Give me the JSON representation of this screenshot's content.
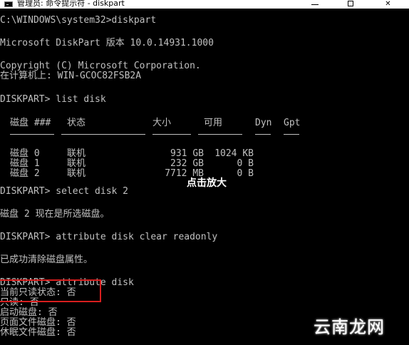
{
  "window": {
    "title": "管理员: 命令提示符 - diskpart",
    "minimize_glyph": "",
    "maximize_glyph": "",
    "close_glyph": "✕"
  },
  "console": {
    "prompt_cmd": "C:\\WINDOWS\\system32>diskpart",
    "version": "Microsoft DiskPart 版本 10.0.14931.1000",
    "copyright": "Copyright (C) Microsoft Corporation.",
    "computer": "在计算机上: WIN-GCOC82FSB2A",
    "list_cmd": "DISKPART> list disk",
    "table": {
      "headers": [
        "磁盘 ###",
        "状态",
        "大小",
        "可用",
        "Dyn",
        "Gpt"
      ],
      "rows": [
        [
          "磁盘 0",
          "联机",
          "931 GB",
          "1024 KB",
          "",
          ""
        ],
        [
          "磁盘 1",
          "联机",
          "232 GB",
          "0 B",
          "",
          ""
        ],
        [
          "磁盘 2",
          "联机",
          "7712 MB",
          "0 B",
          "",
          ""
        ]
      ]
    },
    "select_cmd": "DISKPART> select disk 2",
    "select_result": "磁盘 2 现在是所选磁盘。",
    "clear_cmd": "DISKPART> attribute disk clear readonly",
    "clear_result": "已成功清除磁盘属性。",
    "attr_cmd": "DISKPART> attribute disk",
    "attr_lines": [
      "当前只读状态: 否",
      "只读: 否",
      "启动磁盘: 否",
      "页面文件磁盘: 否",
      "休眠文件磁盘: 否"
    ]
  },
  "overlay": {
    "zoom_hint": "点击放大",
    "watermark": "云南龙网",
    "highlight_color": "#d81e1e"
  }
}
